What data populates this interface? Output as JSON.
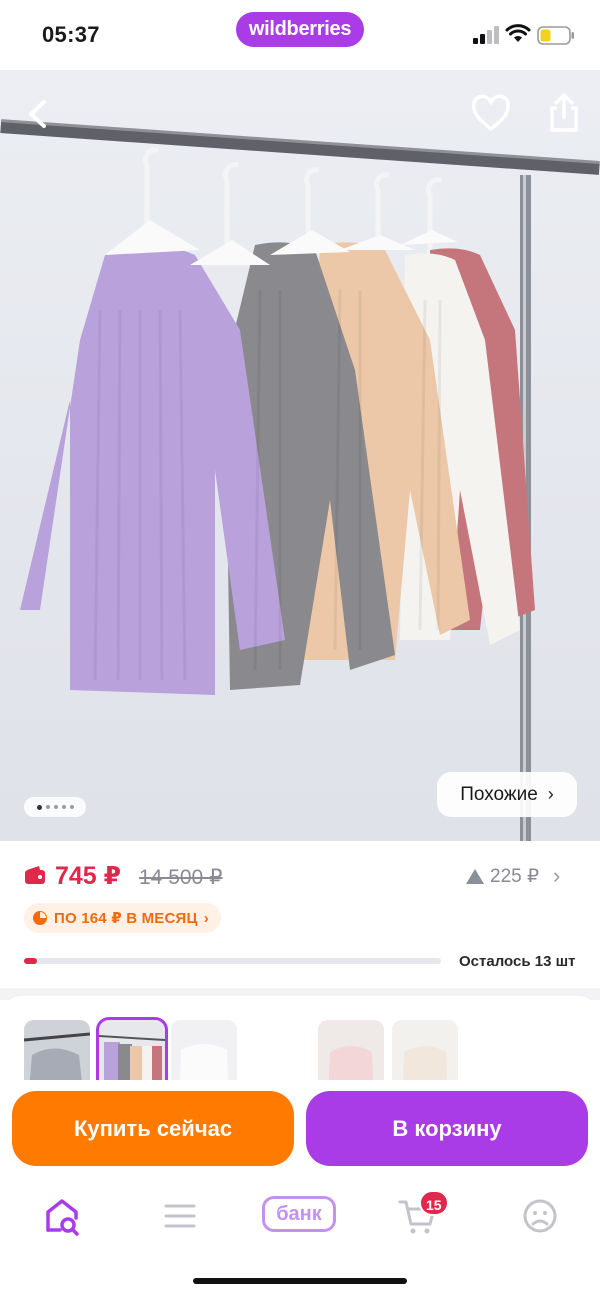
{
  "status_bar": {
    "time": "05:37",
    "brand": "wildberries"
  },
  "product": {
    "image_counter": {
      "total": 5,
      "active": 1
    },
    "similar_label": "Похожие",
    "price": "745 ₽",
    "old_price": "14 500 ₽",
    "price_delta": "225 ₽",
    "installment": "ПО 164 ₽ В МЕСЯЦ",
    "stock_text": "Осталось 13 шт",
    "stock_level": 0.03
  },
  "variants": {
    "selected_index": 1,
    "items": [
      "variant-1",
      "variant-2",
      "variant-3",
      "variant-4",
      "variant-5"
    ]
  },
  "actions": {
    "buy_now": "Купить сейчас",
    "add_to_cart": "В корзину"
  },
  "bottom_nav": {
    "bank_label": "банк",
    "cart_count": "15"
  },
  "colors": {
    "brand": "#a93ce6",
    "buy": "#ff7a00",
    "price": "#e0294a",
    "installment": "#f26a10"
  },
  "icons": [
    "back-icon",
    "heart-icon",
    "share-icon",
    "wallet-icon",
    "chevron-right-icon",
    "installment-icon",
    "home-search-icon",
    "catalog-icon",
    "cart-icon",
    "profile-icon"
  ]
}
